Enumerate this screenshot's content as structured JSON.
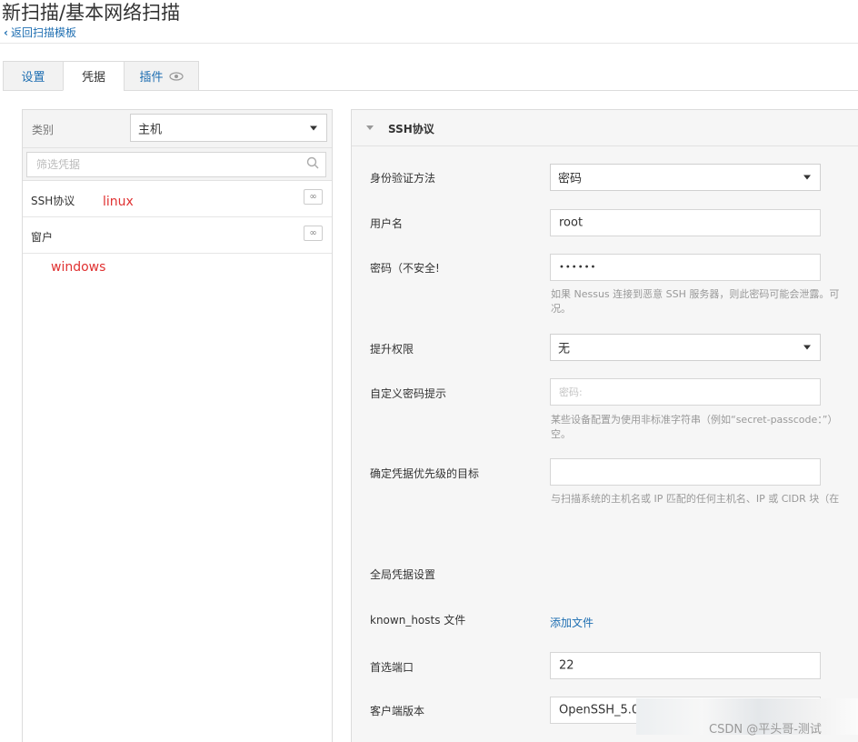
{
  "header": {
    "title": "新扫描/基本网络扫描",
    "back_label": "返回扫描模板"
  },
  "tabs": [
    {
      "label": "设置"
    },
    {
      "label": "凭据"
    },
    {
      "label": "插件"
    }
  ],
  "left": {
    "category_label": "类别",
    "category_value": "主机",
    "filter_placeholder": "筛选凭据",
    "items": [
      {
        "label": "SSH协议",
        "annotation": "linux"
      },
      {
        "label": "窗户",
        "annotation": "windows"
      }
    ]
  },
  "section": {
    "title": "SSH协议"
  },
  "form": {
    "auth_label": "身份验证方法",
    "auth_value": "密码",
    "user_label": "用户名",
    "user_value": "root",
    "pass_label": "密码（不安全!",
    "pass_value": "••••••",
    "pass_help_1": "如果 Nessus 连接到恶意 SSH 服务器，则此密码可能会泄露。可",
    "pass_help_2": "况。",
    "elev_label": "提升权限",
    "elev_value": "无",
    "prompt_label": "自定义密码提示",
    "prompt_placeholder": "密码:",
    "prompt_help_1": "某些设备配置为使用非标准字符串（例如“secret-passcode：”）",
    "prompt_help_2": "空。",
    "target_label": "确定凭据优先级的目标",
    "target_help": "与扫描系统的主机名或 IP 匹配的任何主机名、IP 或 CIDR 块（在",
    "global_label": "全局凭据设置",
    "known_label": "known_hosts 文件",
    "known_link": "添加文件",
    "port_label": "首选端口",
    "port_value": "22",
    "client_label": "客户端版本",
    "client_value": "OpenSSH_5.0"
  },
  "watermark": "CSDN @平头哥-测试"
}
